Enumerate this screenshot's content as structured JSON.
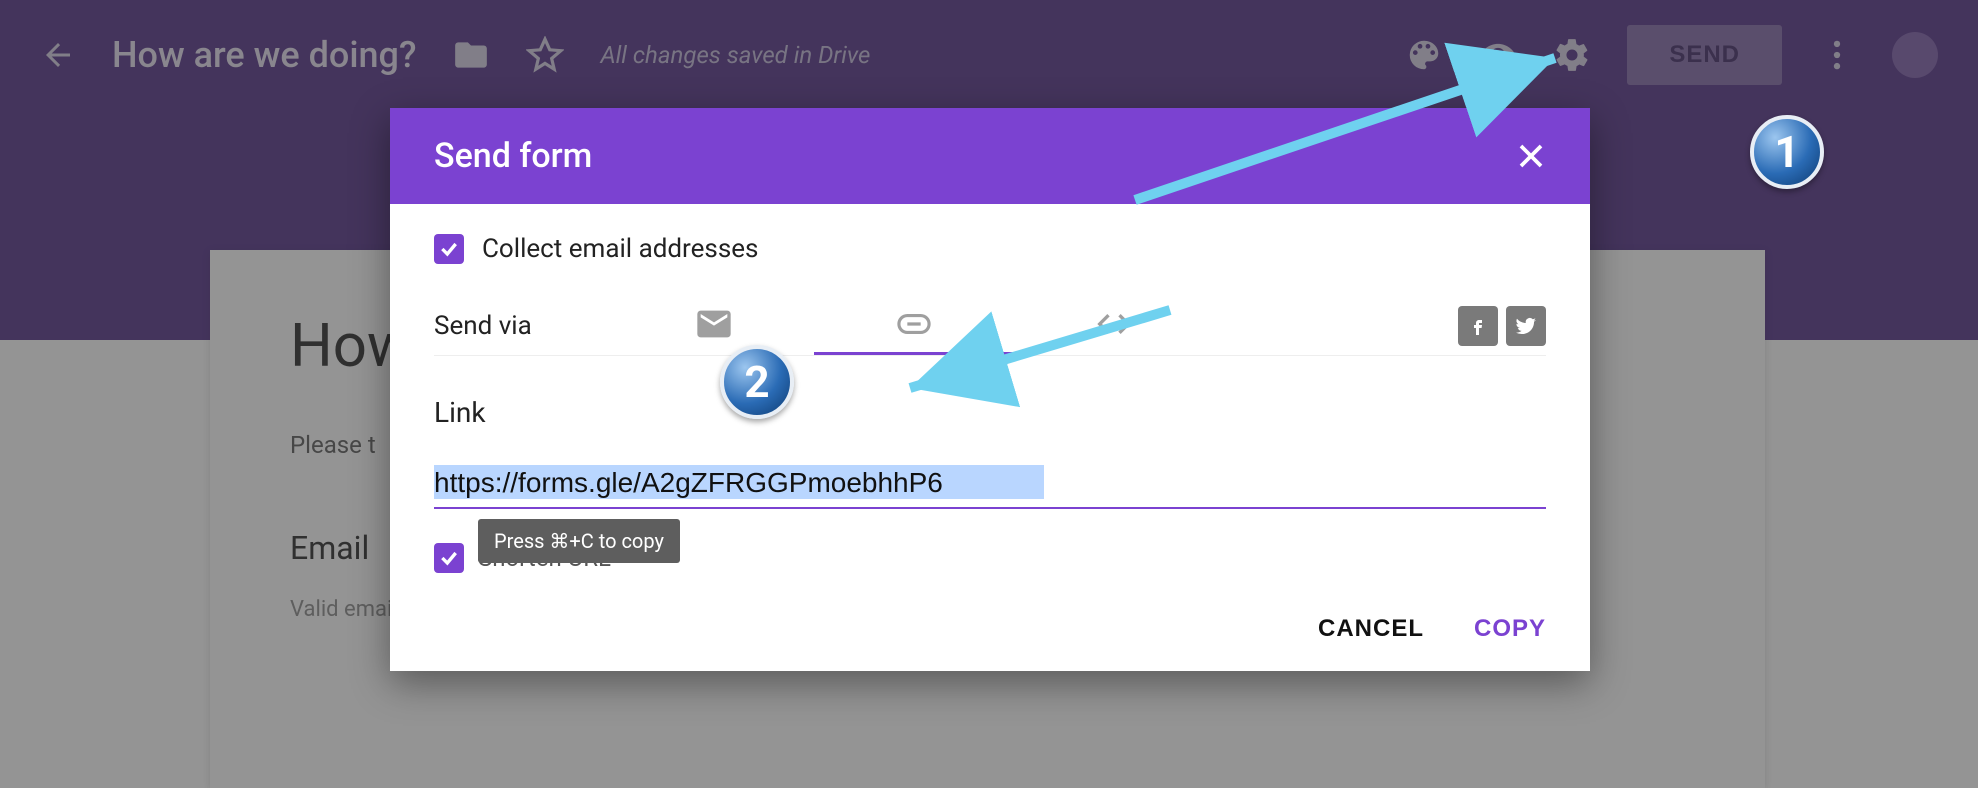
{
  "topbar": {
    "title": "How are we doing?",
    "saved_status": "All changes saved in Drive",
    "send_label": "SEND"
  },
  "formcard": {
    "title": "How",
    "subtitle_prefix": "Please t",
    "section_label": "Email",
    "field_hint": "Valid email address"
  },
  "modal": {
    "title": "Send form",
    "collect_label": "Collect email addresses",
    "collect_checked": true,
    "send_via_label": "Send via",
    "active_tab": "link",
    "link_section_label": "Link",
    "link_value": "https://forms.gle/A2gZFRGGPmoebhhP6",
    "shorten_label": "Shorten URL",
    "shorten_checked": true,
    "tooltip": "Press ⌘+C to copy",
    "cancel_label": "CANCEL",
    "copy_label": "COPY"
  },
  "annotations": {
    "badge1": "1",
    "badge2": "2"
  }
}
